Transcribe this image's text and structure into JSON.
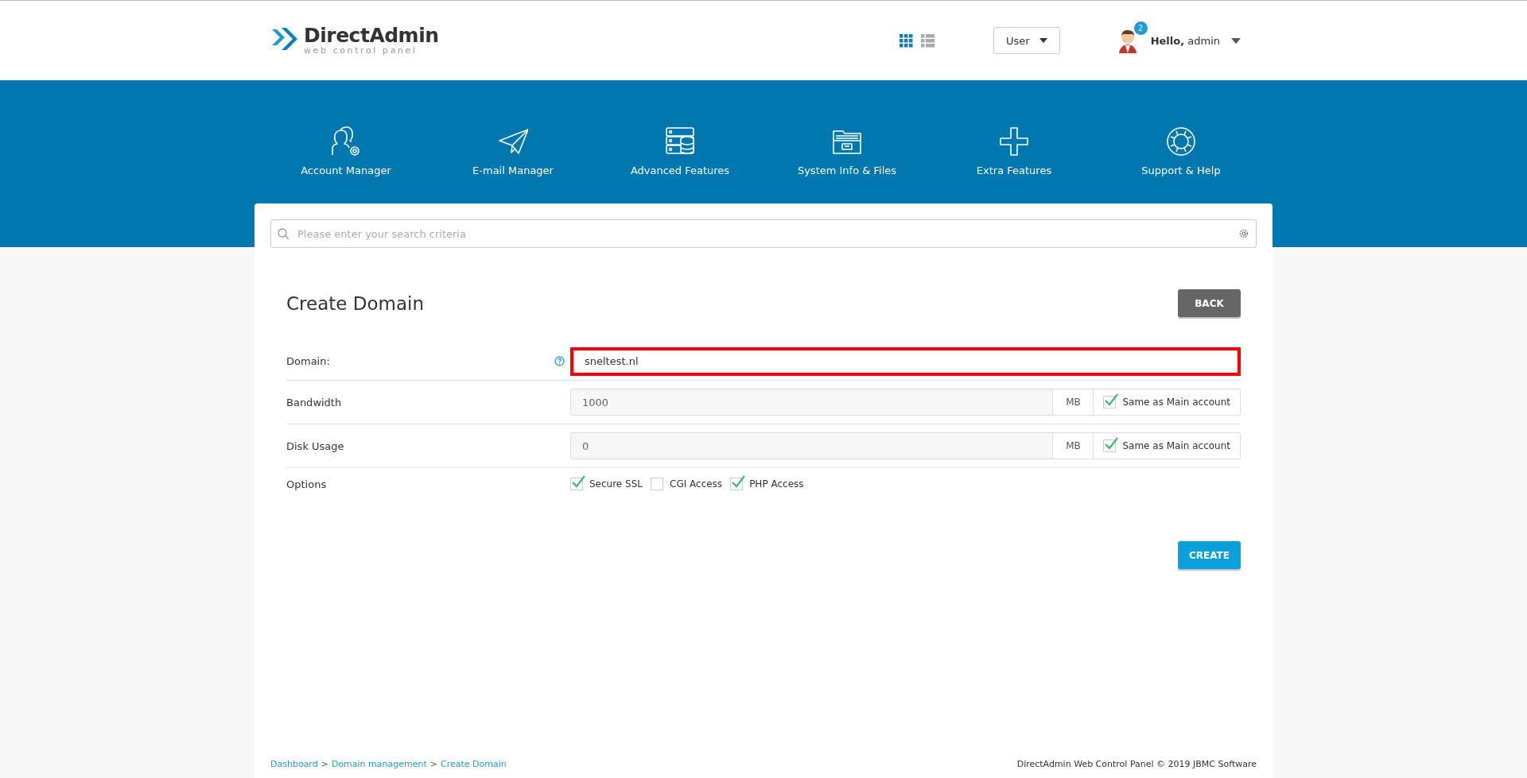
{
  "header": {
    "logo": {
      "title": "DirectAdmin",
      "subtitle": "web control panel"
    },
    "view_toggle": [
      {
        "kind": "grid",
        "selected": true
      },
      {
        "kind": "list",
        "selected": false
      }
    ],
    "level_select": {
      "value": "User"
    },
    "user": {
      "notification_count": "2",
      "greeting": "Hello,",
      "name": "admin"
    }
  },
  "nav": [
    {
      "kind": "account",
      "label": "Account Manager"
    },
    {
      "kind": "email",
      "label": "E-mail Manager"
    },
    {
      "kind": "advanced",
      "label": "Advanced Features"
    },
    {
      "kind": "files",
      "label": "System Info & Files"
    },
    {
      "kind": "extra",
      "label": "Extra Features"
    },
    {
      "kind": "support",
      "label": "Support & Help"
    }
  ],
  "search": {
    "placeholder": "Please enter your search criteria"
  },
  "page": {
    "title": "Create Domain",
    "back_button": "BACK",
    "fields": [
      {
        "kind": "text",
        "label": "Domain:",
        "help": true,
        "value": "sneltest.nl",
        "highlighted": true
      },
      {
        "kind": "quota",
        "label": "Bandwidth",
        "value": "1000",
        "unit": "MB",
        "same_label": "Same as Main account",
        "checked": true
      },
      {
        "kind": "quota",
        "label": "Disk Usage",
        "value": "0",
        "unit": "MB",
        "same_label": "Same as Main account",
        "checked": true
      },
      {
        "kind": "options",
        "label": "Options",
        "options": [
          {
            "label": "Secure SSL",
            "checked": true
          },
          {
            "label": "CGI Access",
            "checked": false
          },
          {
            "label": "PHP Access",
            "checked": true
          }
        ]
      }
    ],
    "create_button": "CREATE"
  },
  "footer": {
    "breadcrumb": [
      {
        "label": "Dashboard",
        "separator": ">"
      },
      {
        "label": "Domain management",
        "separator": ">"
      },
      {
        "label": "Create Domain"
      }
    ],
    "copyright": "DirectAdmin Web Control Panel © 2019 JBMC Software"
  }
}
